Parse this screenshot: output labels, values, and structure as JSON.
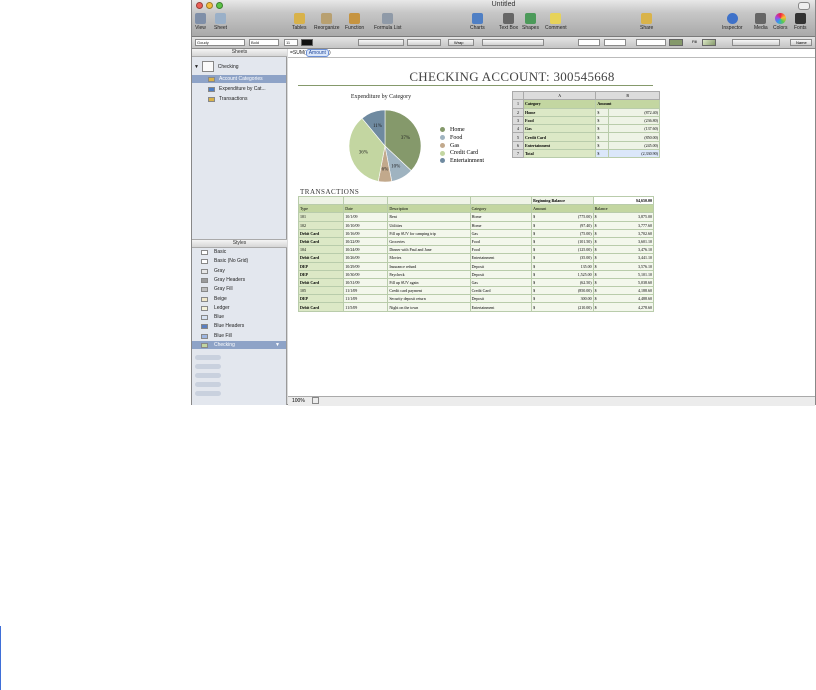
{
  "window": {
    "title": "Untitled"
  },
  "toolbar": {
    "left": [
      {
        "label": "View",
        "icon": "view-icon"
      },
      {
        "label": "Sheet",
        "icon": "sheet-icon"
      }
    ],
    "middle": [
      {
        "label": "Tables",
        "icon": "tables-icon"
      },
      {
        "label": "Reorganize",
        "icon": "reorganize-icon"
      },
      {
        "label": "Function",
        "icon": "function-icon"
      },
      {
        "label": "Formula List",
        "icon": "formula-list-icon"
      }
    ],
    "insert": [
      {
        "label": "Charts",
        "icon": "charts-icon"
      },
      {
        "label": "Text Box",
        "icon": "text-box-icon"
      },
      {
        "label": "Shapes",
        "icon": "shapes-icon"
      },
      {
        "label": "Comment",
        "icon": "comment-icon"
      }
    ],
    "share": {
      "label": "Share",
      "icon": "share-icon"
    },
    "right": [
      {
        "label": "Inspector",
        "icon": "inspector-icon"
      },
      {
        "label": "Media",
        "icon": "media-icon"
      },
      {
        "label": "Colors",
        "icon": "colors-icon"
      },
      {
        "label": "Fonts",
        "icon": "fonts-icon"
      }
    ]
  },
  "format_bar": {
    "font": "Goudy",
    "style": "Bold",
    "size": "11",
    "wrap": "Wrap",
    "fill": "Fill",
    "name": "Name"
  },
  "sidebar": {
    "sheets_header": "Sheets",
    "sheet": "Checking",
    "items": [
      "Account Categories",
      "Expenditure by Cat...",
      "Transactions"
    ],
    "styles_header": "Styles",
    "styles": [
      "Basic",
      "Basic (No Grid)",
      "Gray",
      "Gray Headers",
      "Gray Fill",
      "Beige",
      "Ledger",
      "Blue",
      "Blue Headers",
      "Blue Fill",
      "Checking"
    ]
  },
  "formula": {
    "prefix": "=SUM(",
    "token": "Amount",
    "suffix": ")"
  },
  "sheet_title": "CHECKING ACCOUNT: 300545668",
  "chart": {
    "title": "Expenditure by Category",
    "legend": [
      "Home",
      "Food",
      "Gas",
      "Credit Card",
      "Entertainment"
    ],
    "labels": [
      "37%",
      "10%",
      "6%",
      "36%",
      "11%"
    ],
    "colors": [
      "#85996b",
      "#9fb3c0",
      "#c2a98c",
      "#c3d6a1",
      "#6f8aa0"
    ]
  },
  "chart_data": {
    "type": "pie",
    "title": "Expenditure by Category",
    "categories": [
      "Home",
      "Food",
      "Gas",
      "Credit Card",
      "Entertainment"
    ],
    "values": [
      37,
      10,
      6,
      36,
      11
    ]
  },
  "category_table": {
    "col_headers": [
      "A",
      "B"
    ],
    "header": [
      "Category",
      "Amount"
    ],
    "rows": [
      [
        "Home",
        "$",
        "(872.40)"
      ],
      [
        "Food",
        "$",
        "(236.80)"
      ],
      [
        "Gas",
        "$",
        "(137.60)"
      ],
      [
        "Credit Card",
        "$",
        "(850.00)"
      ],
      [
        "Entertainment",
        "$",
        "(245.00)"
      ],
      [
        "Total",
        "$",
        "(2,330.90)"
      ]
    ]
  },
  "transactions": {
    "title": "TRANSACTIONS",
    "beginning_label": "Beginning Balance",
    "beginning_value": "$4,650.00",
    "headers": [
      "Type",
      "Date",
      "Description",
      "Category",
      "Amount",
      "Balance"
    ],
    "rows": [
      [
        "101",
        "10/1/09",
        "Rent",
        "Home",
        "$",
        "(775.00)",
        "$",
        "3,875.00"
      ],
      [
        "102",
        "10/10/09",
        "Utilities",
        "Home",
        "$",
        "(97.40)",
        "$",
        "3,777.60"
      ],
      [
        "Debit Card",
        "10/16/09",
        "Fill up SUV for camping trip",
        "Gas",
        "$",
        "(75.00)",
        "$",
        "3,702.60"
      ],
      [
        "Debit Card",
        "10/22/09",
        "Groceries",
        "Food",
        "$",
        "(101.50)",
        "$",
        "3,601.10"
      ],
      [
        "104",
        "10/24/09",
        "Dinner with Paul and Jane",
        "Food",
        "$",
        "(125.00)",
        "$",
        "3,476.10"
      ],
      [
        "Debit Card",
        "10/26/09",
        "Movies",
        "Entertainment",
        "$",
        "(35.00)",
        "$",
        "3,441.10"
      ],
      [
        "DEP",
        "10/29/09",
        "Insurance refund",
        "Deposit",
        "$",
        "135.00",
        "$",
        "3,576.10"
      ],
      [
        "DEP",
        "10/30/09",
        "Paycheck",
        "Deposit",
        "$",
        "1,525.00",
        "$",
        "5,101.10"
      ],
      [
        "Debit Card",
        "10/31/09",
        "Fill up SUV again",
        "Gas",
        "$",
        "(62.50)",
        "$",
        "5,038.60"
      ],
      [
        "105",
        "11/1/09",
        "Credit card payment",
        "Credit Card",
        "$",
        "(850.00)",
        "$",
        "4,188.60"
      ],
      [
        "DEP",
        "11/1/09",
        "Security deposit return",
        "Deposit",
        "$",
        "300.00",
        "$",
        "4,488.60"
      ],
      [
        "Debit Card",
        "11/5/09",
        "Night on the town",
        "Entertainment",
        "$",
        "(210.00)",
        "$",
        "4,278.60"
      ]
    ]
  },
  "status": {
    "zoom": "100%"
  }
}
